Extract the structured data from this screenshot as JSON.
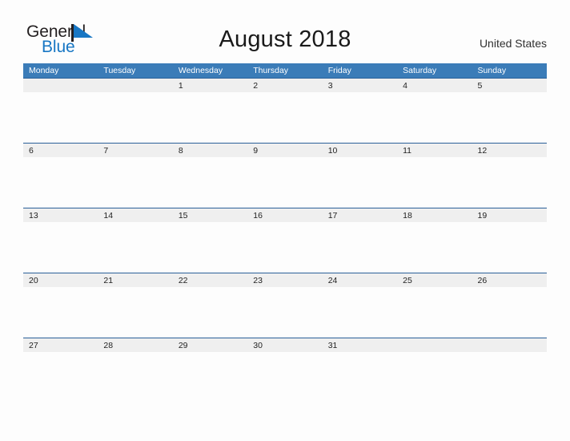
{
  "brand": {
    "name_part1": "General",
    "name_part2": "Blue",
    "mark": "triangle-logo-icon",
    "color_dark": "#231f20",
    "color_blue": "#1877c4"
  },
  "header": {
    "title": "August 2018",
    "region": "United States"
  },
  "theme": {
    "header_blue": "#3b7cb8",
    "row_rule_blue": "#2a6099",
    "date_band_gray": "#efefef",
    "page_background": "#fdfdfd",
    "text_dark": "#1f1f1f",
    "text_white": "#ffffff"
  },
  "calendar": {
    "month": "August",
    "year": "2018",
    "first_day_of_week": "Monday",
    "weekdays": [
      "Monday",
      "Tuesday",
      "Wednesday",
      "Thursday",
      "Friday",
      "Saturday",
      "Sunday"
    ],
    "weeks": [
      [
        "",
        "",
        "1",
        "2",
        "3",
        "4",
        "5"
      ],
      [
        "6",
        "7",
        "8",
        "9",
        "10",
        "11",
        "12"
      ],
      [
        "13",
        "14",
        "15",
        "16",
        "17",
        "18",
        "19"
      ],
      [
        "20",
        "21",
        "22",
        "23",
        "24",
        "25",
        "26"
      ],
      [
        "27",
        "28",
        "29",
        "30",
        "31",
        "",
        ""
      ],
      [
        "",
        "",
        "",
        "",
        "",
        "",
        ""
      ]
    ]
  }
}
